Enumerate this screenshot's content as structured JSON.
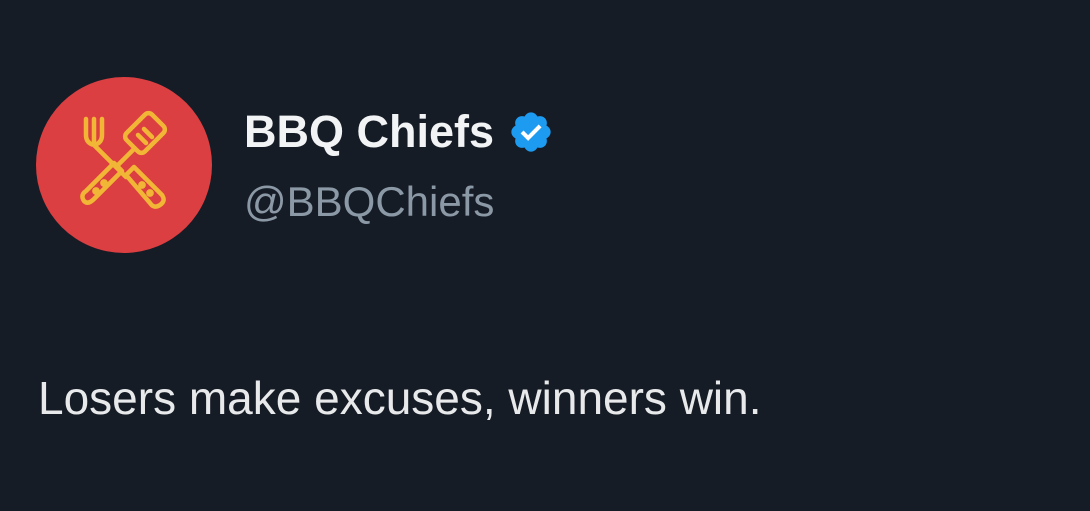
{
  "account": {
    "display_name": "BBQ Chiefs",
    "handle": "@BBQChiefs",
    "verified": true,
    "avatar_icon": "crossed-fork-spatula-icon",
    "avatar_color": "#dc3f41",
    "avatar_icon_color": "#f2b637"
  },
  "tweet": {
    "text": "Losers make excuses, winners win."
  },
  "colors": {
    "background": "#161c26",
    "verified_badge": "#1d9bf0",
    "handle": "#8b98a5",
    "text": "#e7e9ea"
  }
}
